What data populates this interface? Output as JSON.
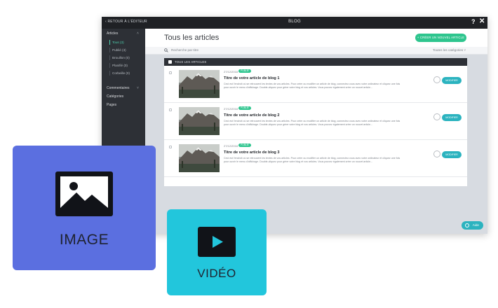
{
  "topbar": {
    "back_label": "‹ RETOUR À L'ÉDITEUR",
    "title": "BLOG",
    "help_label": "?",
    "close_label": "✕"
  },
  "sidebar": {
    "articles_label": "Articles",
    "chevron_up": "˄",
    "chevron_down": "˅",
    "items": [
      {
        "label": "Tous (3)"
      },
      {
        "label": "Publié (3)"
      },
      {
        "label": "Brouillon (0)"
      },
      {
        "label": "Planifié (0)"
      },
      {
        "label": "Corbeille (0)"
      }
    ],
    "comments_label": "Commentaires",
    "categories_label": "Catégories",
    "pages_label": "Pages"
  },
  "header": {
    "title": "Tous les articles",
    "new_article_label": "+ CRÉER UN NOUVEL ARTICLE"
  },
  "search": {
    "placeholder": "Recherche par titre",
    "category_filter": "Toutes les catégories ˅"
  },
  "list": {
    "header_label": "TOUS LES ARTICLES",
    "rows": [
      {
        "date": "27/12/2018",
        "badge": "PUBLIÉ",
        "title": "Titre de votre article de blog 1",
        "description": "Ceci est l'endroit où se retrouvent les textes de vos articles. Pour créer ou modifier un article de blog, connectez-vous avec votre ordinateur et cliquez une fois pour ouvrir le menu d'affichage. Double-cliquez pour gérer votre blog et vos articles. Vous pouvez également créer un nouvel article...",
        "edit_label": "MODIFIER"
      },
      {
        "date": "27/12/2018",
        "badge": "PUBLIÉ",
        "title": "Titre de votre article de blog 2",
        "description": "Ceci est l'endroit où se retrouvent les textes de vos articles. Pour créer ou modifier un article de blog, connectez-vous avec votre ordinateur et cliquez une fois pour ouvrir le menu d'affichage. Double-cliquez pour gérer votre blog et vos articles. Vous pouvez également créer un nouvel article...",
        "edit_label": "MODIFIER"
      },
      {
        "date": "27/12/2018",
        "badge": "PUBLIÉ",
        "title": "Titre de votre article de blog 3",
        "description": "Ceci est l'endroit où se retrouvent les textes de vos articles. Pour créer ou modifier un article de blog, connectez-vous avec votre ordinateur et cliquez une fois pour ouvrir le menu d'affichage. Double-cliquez pour gérer votre blog et vos articles. Vous pouvez également créer un nouvel article...",
        "edit_label": "MODIFIER"
      }
    ]
  },
  "help_button_label": "Aide",
  "cards": {
    "image_label": "IMAGE",
    "video_label": "VIDÉO"
  },
  "colors": {
    "accent_green": "#2ec58e",
    "accent_teal": "#2bb3bf",
    "image_card": "#5b6fe0",
    "video_card": "#22c6dc",
    "dark_panel": "#2d3036"
  },
  "icons": {
    "search": "search-icon",
    "image": "image-icon",
    "video": "play-icon",
    "help": "help-icon",
    "close": "close-icon"
  }
}
